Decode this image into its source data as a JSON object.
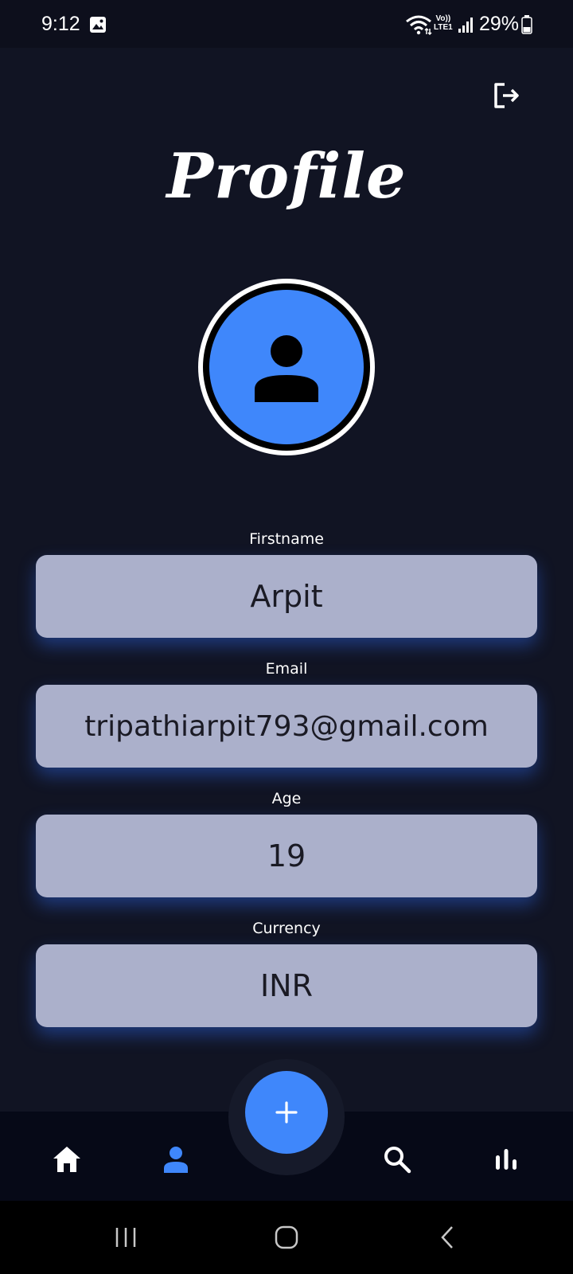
{
  "status_bar": {
    "time": "9:12",
    "volte_line1": "Vo))",
    "volte_line2": "LTE1",
    "battery": "29%"
  },
  "icons": {
    "logout": "logout-icon",
    "avatar": "person-icon",
    "fab": "plus-icon",
    "nav_home": "home-icon",
    "nav_profile": "person-icon",
    "nav_search": "search-icon",
    "nav_stats": "bar-chart-icon"
  },
  "header": {
    "title": "Profile"
  },
  "fields": {
    "firstname": {
      "label": "Firstname",
      "value": "Arpit"
    },
    "email": {
      "label": "Email",
      "value": "tripathiarpit793@gmail.com"
    },
    "age": {
      "label": "Age",
      "value": "19"
    },
    "currency": {
      "label": "Currency",
      "value": "INR"
    }
  },
  "bottom_nav": {
    "active": "profile"
  },
  "colors": {
    "background": "#111423",
    "accent": "#3f87fb",
    "field_bg": "#abb0cb",
    "nav_bg": "#060917"
  }
}
